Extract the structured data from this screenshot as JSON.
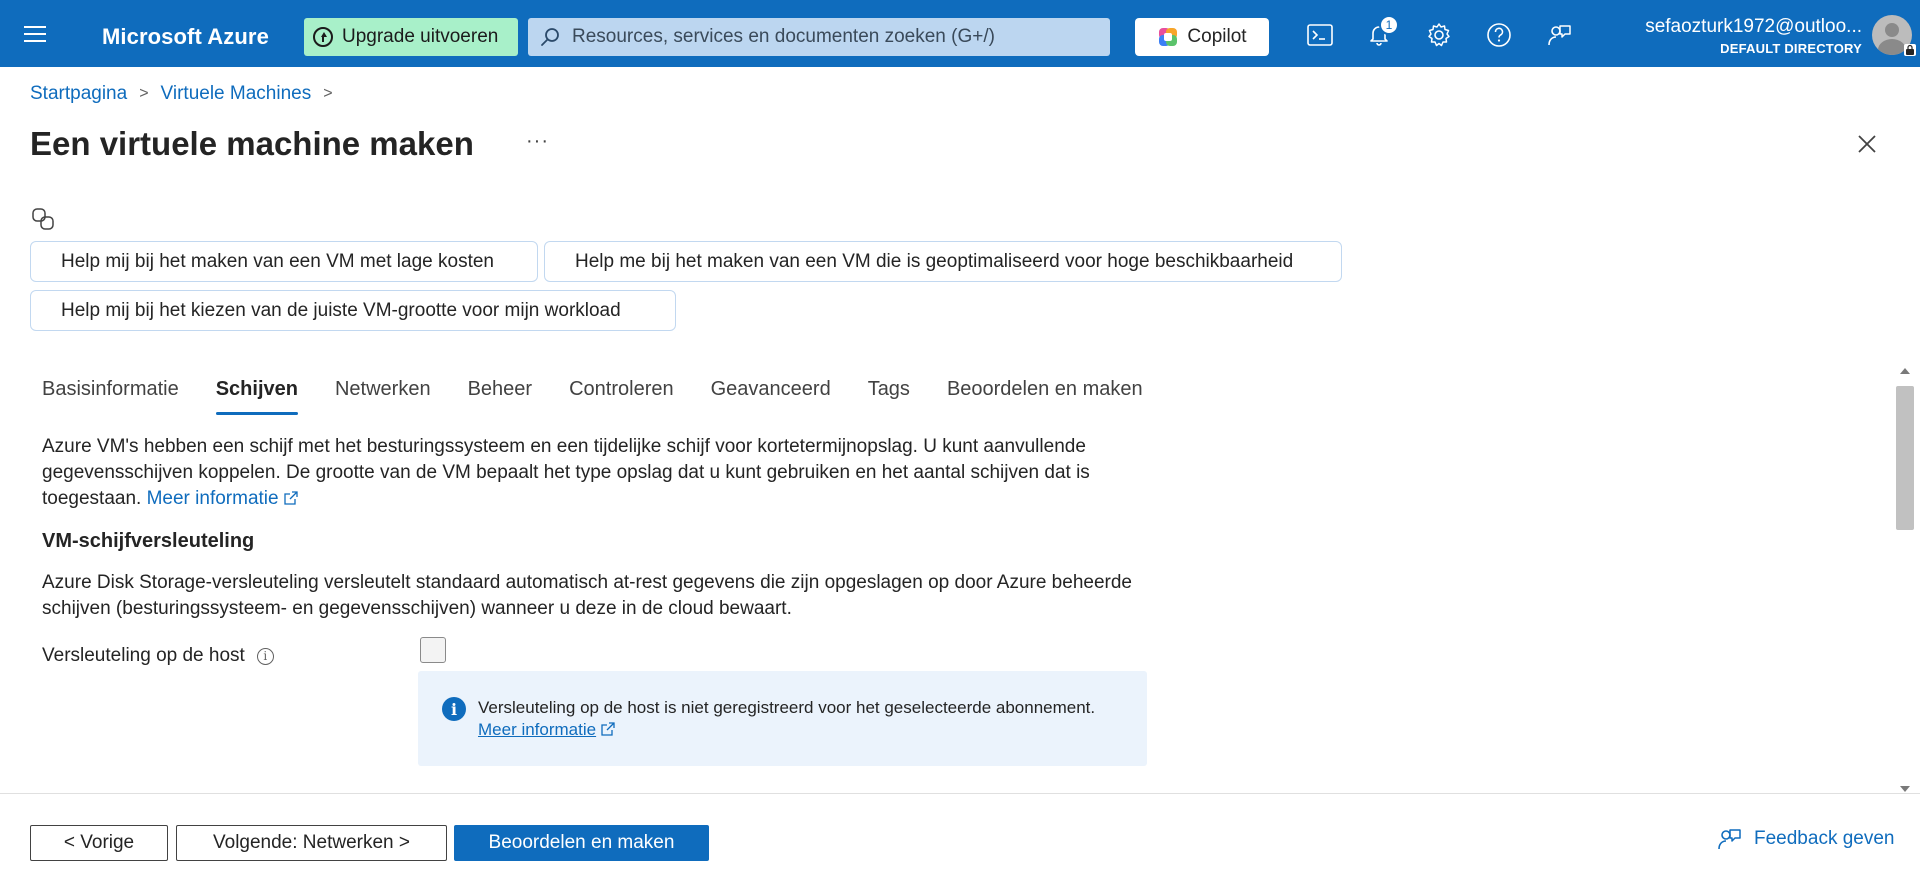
{
  "topbar": {
    "brand": "Microsoft Azure",
    "upgrade_label": "Upgrade uitvoeren",
    "search_placeholder": "Resources, services en documenten zoeken (G+/)",
    "copilot_label": "Copilot",
    "notification_count": "1",
    "user_email": "sefaozturk1972@outloo...",
    "user_directory": "DEFAULT DIRECTORY",
    "icons": [
      "hamburger-icon",
      "upgrade-icon",
      "search-icon",
      "copilot-icon",
      "cloud-shell-icon",
      "bell-icon",
      "gear-icon",
      "help-icon",
      "feedback-icon",
      "avatar"
    ]
  },
  "breadcrumb": {
    "items": [
      "Startpagina",
      "Virtuele Machines"
    ]
  },
  "page": {
    "title": "Een virtuele machine maken",
    "more_label": "···"
  },
  "copilot_suggestions": [
    "Help mij bij het maken van een VM met lage kosten",
    "Help me bij het maken van een VM die is geoptimaliseerd voor hoge beschikbaarheid",
    "Help mij bij het kiezen van de juiste VM-grootte voor mijn workload"
  ],
  "tabs": [
    {
      "label": "Basisinformatie",
      "active": false
    },
    {
      "label": "Schijven",
      "active": true
    },
    {
      "label": "Netwerken",
      "active": false
    },
    {
      "label": "Beheer",
      "active": false
    },
    {
      "label": "Controleren",
      "active": false
    },
    {
      "label": "Geavanceerd",
      "active": false
    },
    {
      "label": "Tags",
      "active": false
    },
    {
      "label": "Beoordelen en maken",
      "active": false
    }
  ],
  "content": {
    "description": "Azure VM's hebben een schijf met het besturingssysteem en een tijdelijke schijf voor kortetermijnopslag. U kunt aanvullende gegevensschijven koppelen. De grootte van de VM bepaalt het type opslag dat u kunt gebruiken en het aantal schijven dat is toegestaan.",
    "learn_more": "Meer informatie",
    "section_title": "VM-schijfversleuteling",
    "section_description": "Azure Disk Storage-versleuteling versleutelt standaard automatisch at-rest gegevens die zijn opgeslagen op door Azure beheerde schijven (besturingssysteem- en gegevensschijven) wanneer u deze in de cloud bewaart.",
    "host_encryption_label": "Versleuteling op de host",
    "host_encryption_checked": false,
    "info_message": "Versleuteling op de host is niet geregistreerd voor het geselecteerde abonnement.",
    "info_link": "Meer informatie"
  },
  "footer": {
    "prev_label": "< Vorige",
    "next_label": "Volgende: Netwerken >",
    "review_label": "Beoordelen en maken",
    "feedback_label": "Feedback geven"
  },
  "colors": {
    "azure_blue": "#0f6cbd",
    "upgrade_green": "#a8f0c9",
    "info_bg": "#ebf3fc"
  }
}
